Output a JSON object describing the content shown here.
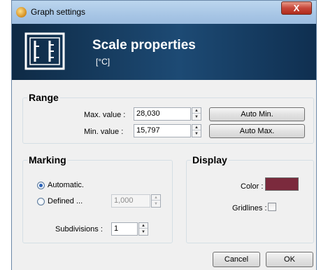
{
  "window": {
    "title": "Graph settings",
    "close_label": "X",
    "app_icon": "graph-app-icon"
  },
  "banner": {
    "title": "Scale properties",
    "subtitle": "[°C]",
    "icon": "scale-icon"
  },
  "range": {
    "title": "Range",
    "max_label": "Max. value :",
    "max_value": "28,030",
    "min_label": "Min. value :",
    "min_value": "15,797",
    "auto_min_label": "Auto Min.",
    "auto_max_label": "Auto Max."
  },
  "marking": {
    "title": "Marking",
    "automatic_label": "Automatic.",
    "defined_label": "Defined ...",
    "defined_value": "1,000",
    "subdivisions_label": "Subdivisions :",
    "subdivisions_value": "1",
    "selected": "automatic"
  },
  "display": {
    "title": "Display",
    "color_label": "Color :",
    "color_value": "#7b2a3d",
    "gridlines_label": "Gridlines :",
    "gridlines_checked": false
  },
  "buttons": {
    "cancel_label": "Cancel",
    "ok_label": "OK"
  }
}
